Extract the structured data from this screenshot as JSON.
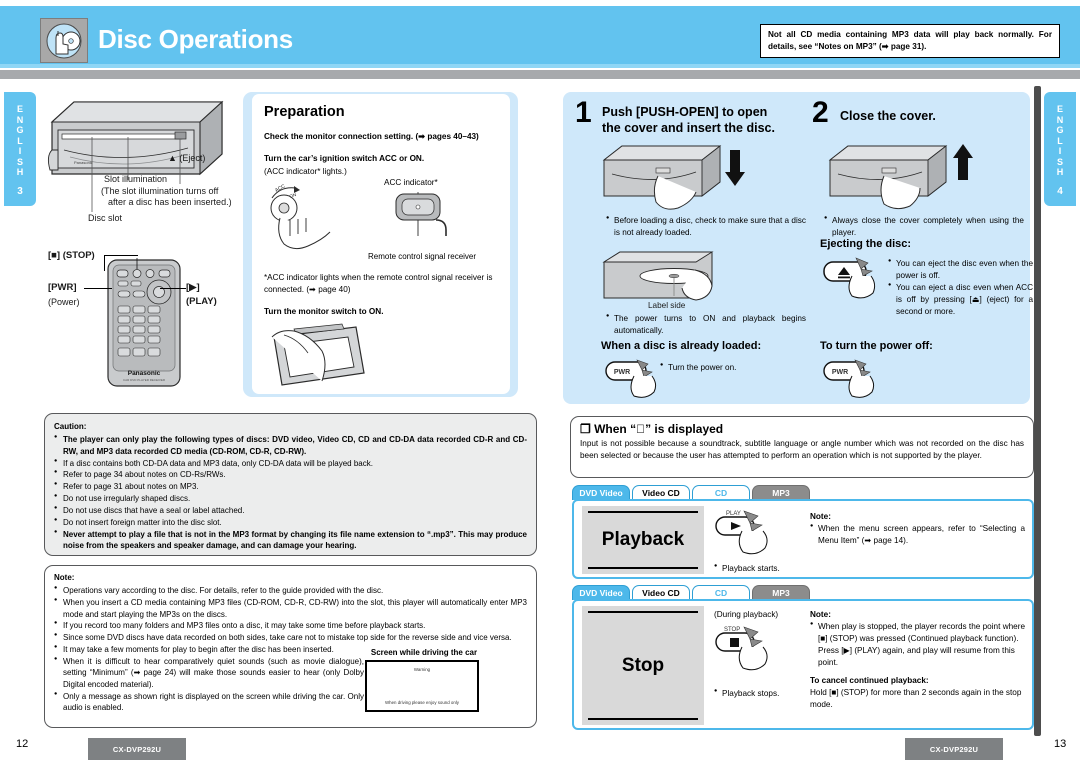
{
  "header": {
    "title": "Disc Operations",
    "icon": "hand-disc-icon",
    "accent_color": "#62c3ef",
    "gray_bar_color": "#a7a9ac",
    "mp3_note": "Not all CD media containing MP3 data will play back normally. For details, see “Notes on MP3” (➡ page 31)."
  },
  "side_tabs": {
    "left": {
      "word": "ENGLISH",
      "number": "3"
    },
    "right": {
      "word": "ENGLISH",
      "number": "4"
    }
  },
  "left_page": {
    "unit_callouts": {
      "eject": "▲ (Eject)",
      "slot_illumination": "Slot illumination",
      "slot_illumination_note_1": "(The slot illumination turns off",
      "slot_illumination_note_2": "after a disc has been inserted.)",
      "disc_slot": "Disc slot"
    },
    "remote_callouts": {
      "stop": "[■] (STOP)",
      "pwr": "[PWR]",
      "power": "(Power)",
      "play_bracket": "[▶]",
      "play": "(PLAY)",
      "brand": "Panasonic",
      "brand_sub": "CAR DVD PLAYER RECEIVER"
    },
    "preparation": {
      "heading": "Preparation",
      "line_1": "Check the monitor connection setting. (➡ pages 40–43)",
      "line_2": "Turn the car’s ignition switch ACC or ON.",
      "line_3": "(ACC indicator* lights.)",
      "acc_indicator_label": "ACC indicator*",
      "receiver_label": "Remote control signal receiver",
      "footnote": "*ACC indicator lights when the remote control signal receiver is connected. (➡ page 40)",
      "line_4": "Turn the monitor switch to ON."
    },
    "caution": {
      "title": "Caution:",
      "items": [
        "The player can only play the following types of discs: DVD video, Video CD, CD and CD-DA data recorded CD-R and CD-RW, and MP3 data recorded CD media (CD-ROM, CD-R, CD-RW).",
        "If a disc contains both CD-DA data and MP3 data, only CD-DA data will be played back.",
        "Refer to page 34 about notes on CD-Rs/RWs.",
        "Refer to page 31 about notes on MP3.",
        "Do not use irregularly shaped discs.",
        "Do not use discs that have a seal or label attached.",
        "Do not insert foreign matter into the disc slot.",
        "Never attempt to play a file that is not in the MP3 format by changing its file name extension to “.mp3”. This may produce noise from the speakers and speaker damage, and can damage your hearing."
      ]
    },
    "note": {
      "title": "Note:",
      "items": [
        "Operations vary according to the disc. For details, refer to the guide provided with the disc.",
        "When you insert a CD media containing MP3 files (CD-ROM, CD-R, CD-RW) into the slot, this player will automatically enter MP3 mode and start playing the MP3s on the discs.",
        "If you record too many folders and MP3 files onto a disc, it may take some time before playback starts.",
        "Since some DVD discs have data recorded on both sides, take care not to mistake top side for the reverse side and vice versa.",
        "It may take a few moments for play to begin after the disc has been inserted.",
        "When it is difficult to hear comparatively quiet sounds (such as movie dialogue), setting “Minimum” (➡ page 24) will make those sounds easier to hear (only Dolby Digital encoded material).",
        "Only a message as shown right is displayed on the screen while driving the car. Only audio is enabled."
      ]
    },
    "driving_screen": {
      "title": "Screen while driving the car",
      "screen_top": "Warning",
      "screen_bottom": "When driving please enjoy sound only"
    },
    "page_number": "12",
    "model": "CX-DVP292U"
  },
  "right_page": {
    "step1": {
      "number": "1",
      "heading_line_1": "Push [PUSH-OPEN] to open",
      "heading_line_2": "the cover and insert the disc.",
      "bullet_1": "Before loading a disc, check to make sure that a disc is not already loaded.",
      "label_side": "Label side",
      "bullet_2": "The power turns to ON and playback begins automatically.",
      "subheading": "When a disc is already loaded:",
      "sub_bullet": "Turn the power on.",
      "key": "PWR"
    },
    "step2": {
      "number": "2",
      "heading": "Close the cover.",
      "bullet_1": "Always close the cover completely when using the player.",
      "eject_subheading": "Ejecting the disc:",
      "eject_bullets": [
        "You can eject the disc even when the power is off.",
        "You can eject a disc even when ACC is off by pressing [⏏] (eject) for a second or more."
      ],
      "power_off_subheading": "To turn the power off:",
      "key_eject": "▲",
      "key_pwr": "PWR"
    },
    "nosign": {
      "heading": "❐ When “⃠” is displayed",
      "body": "Input is not possible because a soundtrack, subtitle language or angle number which was not recorded on the disc has been selected or because the user has attempted to perform an operation which is not supported by the player."
    },
    "tabs": [
      {
        "label": "DVD Video",
        "style": "blue"
      },
      {
        "label": "Video CD",
        "style": "white"
      },
      {
        "label": "CD",
        "style": "cdb"
      },
      {
        "label": "MP3",
        "style": "gray"
      }
    ],
    "playback": {
      "screen_word": "Playback",
      "key_label": "PLAY",
      "key_glyph": "▶",
      "bullet": "Playback starts.",
      "note_title": "Note:",
      "note_items": [
        "When the menu screen appears, refer to “Selecting a Menu Item” (➡ page 14)."
      ]
    },
    "stop": {
      "screen_word": "Stop",
      "during": "(During playback)",
      "key_label": "STOP",
      "key_glyph": "■",
      "bullet": "Playback stops.",
      "note_title": "Note:",
      "note_body_1": "When play is stopped, the player records the point where [■] (STOP) was pressed (Continued playback function).",
      "note_body_2": "Press [▶] (PLAY) again, and play will resume from this point.",
      "cancel_title": "To cancel continued playback:",
      "cancel_body": "Hold [■] (STOP) for more than 2 seconds again in the stop mode."
    },
    "page_number": "13",
    "model": "CX-DVP292U"
  }
}
